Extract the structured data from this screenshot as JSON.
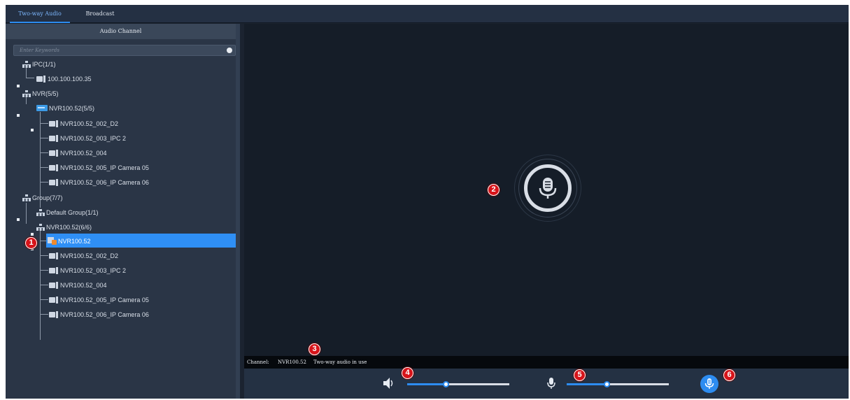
{
  "tabs": [
    {
      "label": "Two-way Audio",
      "active": true
    },
    {
      "label": "Broadcast",
      "active": false
    }
  ],
  "panel": {
    "title": "Audio Channel"
  },
  "search": {
    "placeholder": "Enter Keywords"
  },
  "tree": {
    "ipc_root": "IPC(1/1)",
    "ipc_1": "100.100.100.35",
    "nvr_root": "NVR(5/5)",
    "nvr_device": "NVR100.52(5/5)",
    "nvr_ch": [
      "NVR100.52_002_D2",
      "NVR100.52_003_IPC 2",
      "NVR100.52_004",
      "NVR100.52_005_IP Camera 05",
      "NVR100.52_006_IP Camera 06"
    ],
    "group_root": "Group(7/7)",
    "default_group": "Default Group(1/1)",
    "nvr_group": "NVR100.52(6/6)",
    "group_selected": "NVR100.52",
    "group_ch": [
      "NVR100.52_002_D2",
      "NVR100.52_003_IPC 2",
      "NVR100.52_004",
      "NVR100.52_005_IP Camera 05",
      "NVR100.52_006_IP Camera 06"
    ]
  },
  "status": {
    "channel_label": "Channel:",
    "channel_value": "NVR100.52",
    "message": "Two-way audio in use"
  },
  "controls": {
    "speaker_volume": 0.38,
    "mic_volume": 0.39
  },
  "callouts": [
    "1",
    "2",
    "3",
    "4",
    "5",
    "6"
  ],
  "colors": {
    "accent": "#2d8cf0",
    "callout": "#d7141a",
    "selected_row": "#2f8ff5"
  },
  "icons": [
    "group-icon",
    "camera-icon",
    "nvr-icon",
    "microphone-icon",
    "speaker-icon"
  ]
}
